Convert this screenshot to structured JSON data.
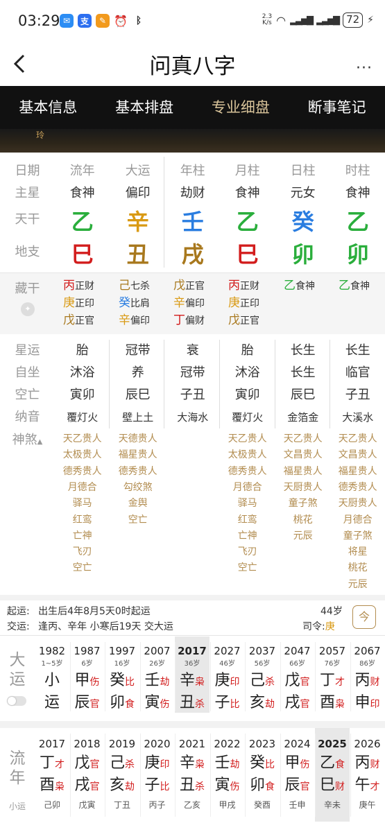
{
  "status": {
    "time": "03:29",
    "speed_top": "2.3",
    "speed_bottom": "K/s",
    "battery": "72"
  },
  "nav": {
    "title": "问真八字",
    "more": "···"
  },
  "tabs": [
    {
      "label": "基本信息"
    },
    {
      "label": "基本排盘"
    },
    {
      "label": "专业细盘",
      "active": true
    },
    {
      "label": "断事笔记"
    }
  ],
  "banner_text": "玲",
  "grid": {
    "row_labels": {
      "header": "日期",
      "zhuxing": "主星",
      "tiangan": "天干",
      "dizhi": "地支"
    },
    "columns": [
      {
        "header": "流年",
        "zhuxing": "食神",
        "tg": "乙",
        "dz": "巳"
      },
      {
        "header": "大运",
        "zhuxing": "偏印",
        "tg": "辛",
        "dz": "丑"
      },
      {
        "header": "年柱",
        "zhuxing": "劫财",
        "tg": "壬",
        "dz": "戌"
      },
      {
        "header": "月柱",
        "zhuxing": "食神",
        "tg": "乙",
        "dz": "巳"
      },
      {
        "header": "日柱",
        "zhuxing": "元女",
        "tg": "癸",
        "dz": "卯"
      },
      {
        "header": "时柱",
        "zhuxing": "食神",
        "tg": "乙",
        "dz": "卯"
      }
    ],
    "colors": {
      "green": "#2aae3c",
      "red": "#d21d1d",
      "orange": "#d99a14",
      "blue": "#2a7de0",
      "brown": "#a8781d"
    }
  },
  "canggan": {
    "label": "藏干",
    "cols": [
      [
        {
          "g": "丙",
          "s": "正财"
        },
        {
          "g": "庚",
          "s": "正印"
        },
        {
          "g": "戊",
          "s": "正官"
        }
      ],
      [
        {
          "g": "己",
          "s": "七杀"
        },
        {
          "g": "癸",
          "s": "比肩"
        },
        {
          "g": "辛",
          "s": "偏印"
        }
      ],
      [
        {
          "g": "戊",
          "s": "正官"
        },
        {
          "g": "辛",
          "s": "偏印"
        },
        {
          "g": "丁",
          "s": "偏财"
        }
      ],
      [
        {
          "g": "丙",
          "s": "正财"
        },
        {
          "g": "庚",
          "s": "正印"
        },
        {
          "g": "戊",
          "s": "正官"
        }
      ],
      [
        {
          "g": "乙",
          "s": "食神"
        }
      ],
      [
        {
          "g": "乙",
          "s": "食神"
        }
      ]
    ]
  },
  "info": {
    "labels": [
      "星运",
      "自坐",
      "空亡",
      "纳音"
    ],
    "cols": [
      [
        "胎",
        "沐浴",
        "寅卯",
        "覆灯火"
      ],
      [
        "冠带",
        "养",
        "辰巳",
        "壁上土"
      ],
      [
        "衰",
        "冠带",
        "子丑",
        "大海水"
      ],
      [
        "胎",
        "沐浴",
        "寅卯",
        "覆灯火"
      ],
      [
        "长生",
        "长生",
        "辰巳",
        "金箔金"
      ],
      [
        "长生",
        "临官",
        "子丑",
        "大溪水"
      ]
    ]
  },
  "shensha": {
    "label": "神煞",
    "cols": [
      [
        "天乙贵人",
        "太极贵人",
        "德秀贵人",
        "月德合",
        "驿马",
        "红鸾",
        "亡神",
        "飞刃",
        "空亡"
      ],
      [
        "天德贵人",
        "福星贵人",
        "德秀贵人",
        "勾绞煞",
        "金舆",
        "空亡"
      ],
      [],
      [
        "天乙贵人",
        "太极贵人",
        "德秀贵人",
        "月德合",
        "驿马",
        "红鸾",
        "亡神",
        "飞刃",
        "空亡"
      ],
      [
        "天乙贵人",
        "文昌贵人",
        "福星贵人",
        "天厨贵人",
        "童子煞",
        "桃花",
        "元辰"
      ],
      [
        "天乙贵人",
        "文昌贵人",
        "福星贵人",
        "德秀贵人",
        "天厨贵人",
        "月德合",
        "童子煞",
        "将星",
        "桃花",
        "元辰"
      ]
    ]
  },
  "qiyun": {
    "l1_label": "起运:",
    "l1_text": "出生后4年8月5天0时起运",
    "l2_label": "交运:",
    "l2_text": "逢丙、辛年 小寒后19天 交大运",
    "age": "44岁",
    "siling_label": "司令:",
    "siling_value": "庚",
    "today_icon": "今"
  },
  "dayun": {
    "label": "大运",
    "cols": [
      {
        "year": "1982",
        "age": "1~5岁",
        "g": "小",
        "z": "运",
        "gs": "",
        "zs": ""
      },
      {
        "year": "1987",
        "age": "6岁",
        "g": "甲",
        "gs": "伤",
        "z": "辰",
        "zs": "官"
      },
      {
        "year": "1997",
        "age": "16岁",
        "g": "癸",
        "gs": "比",
        "z": "卯",
        "zs": "食"
      },
      {
        "year": "2007",
        "age": "26岁",
        "g": "壬",
        "gs": "劫",
        "z": "寅",
        "zs": "伤"
      },
      {
        "year": "2017",
        "age": "36岁",
        "g": "辛",
        "gs": "枭",
        "z": "丑",
        "zs": "杀",
        "hl": true
      },
      {
        "year": "2027",
        "age": "46岁",
        "g": "庚",
        "gs": "印",
        "z": "子",
        "zs": "比"
      },
      {
        "year": "2037",
        "age": "56岁",
        "g": "己",
        "gs": "杀",
        "z": "亥",
        "zs": "劫"
      },
      {
        "year": "2047",
        "age": "66岁",
        "g": "戊",
        "gs": "官",
        "z": "戌",
        "zs": "官"
      },
      {
        "year": "2057",
        "age": "76岁",
        "g": "丁",
        "gs": "才",
        "z": "酉",
        "zs": "枭"
      },
      {
        "year": "2067",
        "age": "86岁",
        "g": "丙",
        "gs": "财",
        "z": "申",
        "zs": "印"
      }
    ]
  },
  "liunian": {
    "label": "流年",
    "sub": "小运",
    "cols": [
      {
        "year": "2017",
        "g": "丁",
        "gs": "才",
        "z": "酉",
        "zs": "枭",
        "xy": "己卯"
      },
      {
        "year": "2018",
        "g": "戊",
        "gs": "官",
        "z": "戌",
        "zs": "官",
        "xy": "戊寅"
      },
      {
        "year": "2019",
        "g": "己",
        "gs": "杀",
        "z": "亥",
        "zs": "劫",
        "xy": "丁丑"
      },
      {
        "year": "2020",
        "g": "庚",
        "gs": "印",
        "z": "子",
        "zs": "比",
        "xy": "丙子"
      },
      {
        "year": "2021",
        "g": "辛",
        "gs": "枭",
        "z": "丑",
        "zs": "杀",
        "xy": "乙亥"
      },
      {
        "year": "2022",
        "g": "壬",
        "gs": "劫",
        "z": "寅",
        "zs": "伤",
        "xy": "甲戌"
      },
      {
        "year": "2023",
        "g": "癸",
        "gs": "比",
        "z": "卯",
        "zs": "食",
        "xy": "癸酉"
      },
      {
        "year": "2024",
        "g": "甲",
        "gs": "伤",
        "z": "辰",
        "zs": "官",
        "xy": "壬申"
      },
      {
        "year": "2025",
        "g": "乙",
        "gs": "食",
        "z": "巳",
        "zs": "财",
        "xy": "辛未",
        "hl": true
      },
      {
        "year": "2026",
        "g": "丙",
        "gs": "财",
        "z": "午",
        "zs": "才",
        "xy": "庚午"
      }
    ]
  }
}
